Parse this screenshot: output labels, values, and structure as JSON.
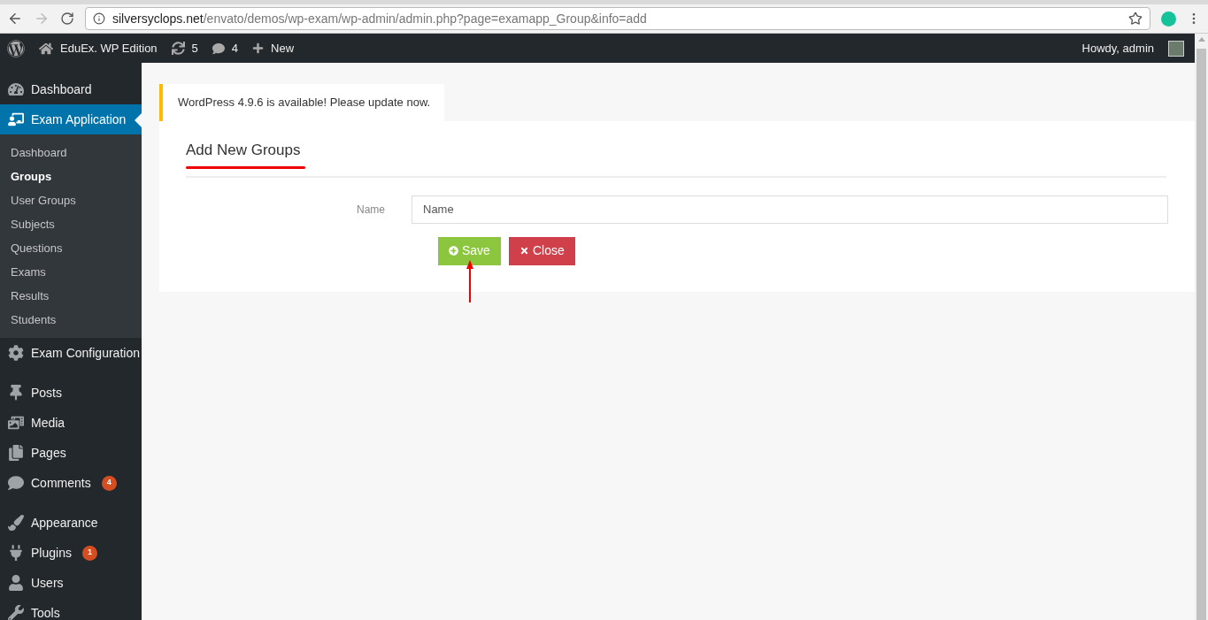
{
  "browser": {
    "url_host": "silversyclops.net",
    "url_path": "/envato/demos/wp-exam/wp-admin/admin.php?page=examapp_Group&info=add"
  },
  "admin_bar": {
    "site": "EduEx. WP Edition",
    "updates": "5",
    "comments": "4",
    "new": "New",
    "greeting": "Howdy, admin"
  },
  "sidebar": {
    "sections": [
      [
        {
          "label": "Dashboard",
          "selected": false
        },
        {
          "label": "Exam Application",
          "selected": true,
          "children": [
            {
              "label": "Dashboard",
              "selected": false
            },
            {
              "label": "Groups",
              "selected": true
            },
            {
              "label": "User Groups",
              "selected": false
            },
            {
              "label": "Subjects",
              "selected": false
            },
            {
              "label": "Questions",
              "selected": false
            },
            {
              "label": "Exams",
              "selected": false
            },
            {
              "label": "Results",
              "selected": false
            },
            {
              "label": "Students",
              "selected": false
            }
          ]
        },
        {
          "label": "Exam Configuration",
          "selected": false
        }
      ],
      [
        {
          "label": "Posts",
          "selected": false
        },
        {
          "label": "Media",
          "selected": false
        },
        {
          "label": "Pages",
          "selected": false
        },
        {
          "label": "Comments",
          "selected": false,
          "badge": "4"
        }
      ],
      [
        {
          "label": "Appearance",
          "selected": false
        },
        {
          "label": "Plugins",
          "selected": false,
          "badge": "1"
        },
        {
          "label": "Users",
          "selected": false
        },
        {
          "label": "Tools",
          "selected": false
        }
      ]
    ]
  },
  "notice": "WordPress 4.9.6 is available! Please update now.",
  "form": {
    "title": "Add New Groups",
    "field_label": "Name",
    "placeholder": "Name",
    "buttons": [
      {
        "label": "Save",
        "kind": "save"
      },
      {
        "label": "Close",
        "kind": "close"
      }
    ]
  }
}
